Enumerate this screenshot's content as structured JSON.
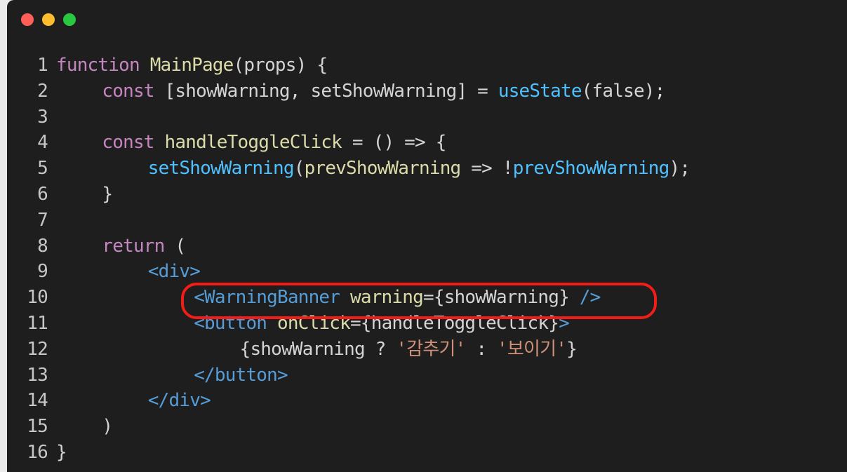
{
  "window": {
    "controls": [
      {
        "name": "close",
        "color": "#ff5f57"
      },
      {
        "name": "minimize",
        "color": "#febc2e"
      },
      {
        "name": "maximize",
        "color": "#28c840"
      }
    ]
  },
  "colors": {
    "keyword": "#c586c0",
    "function": "#dcdcaa",
    "method": "#4fc1ff",
    "tag": "#569cd6",
    "string": "#ce9178",
    "text": "#d4d4d4",
    "highlight": "#f21d16"
  },
  "code": {
    "lines": [
      {
        "number": "1",
        "indent": 0,
        "tokens": [
          {
            "t": "function",
            "c": "keyword"
          },
          {
            "t": " ",
            "c": "text"
          },
          {
            "t": "MainPage",
            "c": "function"
          },
          {
            "t": "(props) {",
            "c": "text"
          }
        ]
      },
      {
        "number": "2",
        "indent": 4,
        "tokens": [
          {
            "t": "const",
            "c": "keyword"
          },
          {
            "t": " [showWarning, setShowWarning] = ",
            "c": "text"
          },
          {
            "t": "useState",
            "c": "method"
          },
          {
            "t": "(false);",
            "c": "text"
          }
        ]
      },
      {
        "number": "3",
        "indent": 0,
        "tokens": []
      },
      {
        "number": "4",
        "indent": 4,
        "tokens": [
          {
            "t": "const",
            "c": "keyword"
          },
          {
            "t": " ",
            "c": "text"
          },
          {
            "t": "handleToggleClick",
            "c": "function"
          },
          {
            "t": " = () => {",
            "c": "text"
          }
        ]
      },
      {
        "number": "5",
        "indent": 8,
        "tokens": [
          {
            "t": "setShowWarning",
            "c": "method"
          },
          {
            "t": "(",
            "c": "text"
          },
          {
            "t": "prevShowWarning",
            "c": "function"
          },
          {
            "t": " => !",
            "c": "text"
          },
          {
            "t": "prevShowWarning",
            "c": "method"
          },
          {
            "t": ");",
            "c": "text"
          }
        ]
      },
      {
        "number": "6",
        "indent": 4,
        "tokens": [
          {
            "t": "}",
            "c": "text"
          }
        ]
      },
      {
        "number": "7",
        "indent": 0,
        "tokens": []
      },
      {
        "number": "8",
        "indent": 4,
        "tokens": [
          {
            "t": "return",
            "c": "keyword"
          },
          {
            "t": " (",
            "c": "text"
          }
        ]
      },
      {
        "number": "9",
        "indent": 8,
        "tokens": [
          {
            "t": "<div>",
            "c": "tag"
          }
        ]
      },
      {
        "number": "10",
        "indent": 12,
        "tokens": [
          {
            "t": "<WarningBanner",
            "c": "tag"
          },
          {
            "t": " ",
            "c": "text"
          },
          {
            "t": "warning",
            "c": "function"
          },
          {
            "t": "={showWarning} ",
            "c": "text"
          },
          {
            "t": "/>",
            "c": "tag"
          }
        ]
      },
      {
        "number": "11",
        "indent": 12,
        "tokens": [
          {
            "t": "<button",
            "c": "tag"
          },
          {
            "t": " ",
            "c": "text"
          },
          {
            "t": "onClick",
            "c": "function"
          },
          {
            "t": "={handleToggleClick}",
            "c": "text"
          },
          {
            "t": ">",
            "c": "tag"
          }
        ]
      },
      {
        "number": "12",
        "indent": 16,
        "tokens": [
          {
            "t": "{showWarning ? ",
            "c": "text"
          },
          {
            "t": "'감추기'",
            "c": "string"
          },
          {
            "t": " : ",
            "c": "text"
          },
          {
            "t": "'보이기'",
            "c": "string"
          },
          {
            "t": "}",
            "c": "text"
          }
        ]
      },
      {
        "number": "13",
        "indent": 12,
        "tokens": [
          {
            "t": "</button>",
            "c": "tag"
          }
        ]
      },
      {
        "number": "14",
        "indent": 8,
        "tokens": [
          {
            "t": "</div>",
            "c": "tag"
          }
        ]
      },
      {
        "number": "15",
        "indent": 4,
        "tokens": [
          {
            "t": ")",
            "c": "text"
          }
        ]
      },
      {
        "number": "16",
        "indent": 0,
        "tokens": [
          {
            "t": "}",
            "c": "text"
          }
        ]
      }
    ],
    "highlighted_line": "10"
  }
}
